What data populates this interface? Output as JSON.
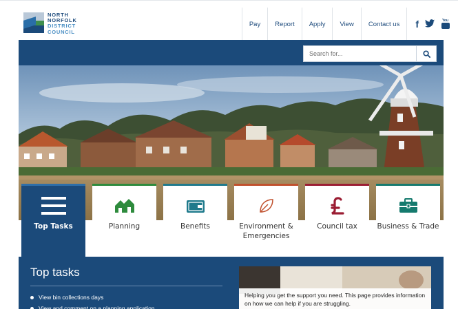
{
  "header": {
    "logo_lines": [
      "NORTH",
      "NORFOLK",
      "DISTRICT",
      "COUNCIL"
    ],
    "nav": [
      "Pay",
      "Report",
      "Apply",
      "View",
      "Contact us"
    ],
    "social": {
      "facebook": "f",
      "youtube": "You"
    }
  },
  "search": {
    "placeholder": "Search for..."
  },
  "tiles": [
    {
      "label": "Top Tasks",
      "icon": "menu-icon",
      "accent": "#1b4a7a"
    },
    {
      "label": "Planning",
      "icon": "houses-icon",
      "accent": "#2e8b3d"
    },
    {
      "label": "Benefits",
      "icon": "wallet-icon",
      "accent": "#1f7a8c"
    },
    {
      "label": "Environment & Emergencies",
      "icon": "leaf-icon",
      "accent": "#c0502d"
    },
    {
      "label": "Council tax",
      "icon": "pound-icon",
      "accent": "#9b1d33"
    },
    {
      "label": "Business & Trade",
      "icon": "briefcase-icon",
      "accent": "#157a6e"
    }
  ],
  "content": {
    "heading": "Top tasks",
    "tasks": [
      "View bin collections days",
      "View and comment on a planning application"
    ],
    "promo_text": "Helping you get the support you need. This page provides information on how we can help if you are struggling."
  },
  "colors": {
    "brand": "#1b4a7a",
    "brand_light": "#2f6fa8",
    "green": "#2e8b3d"
  }
}
